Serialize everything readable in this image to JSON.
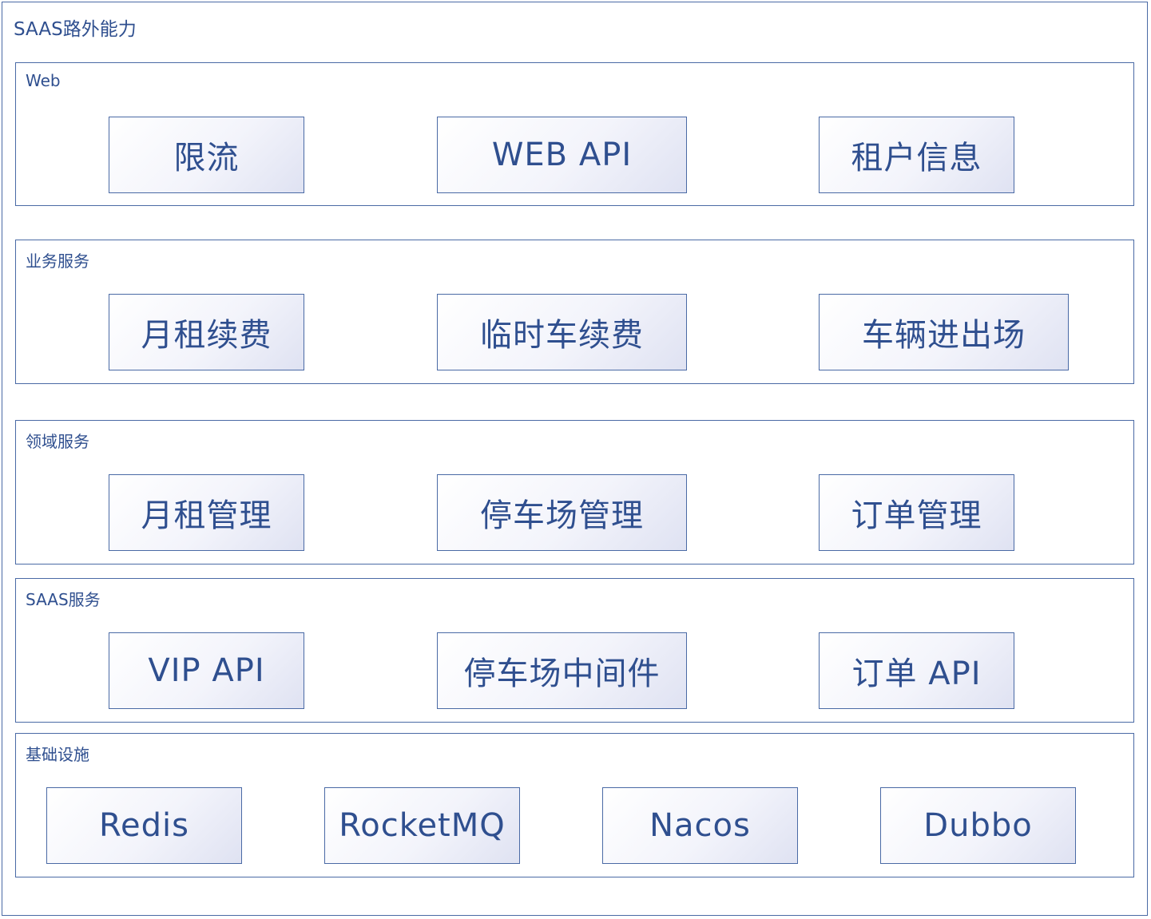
{
  "title": "SAAS路外能力",
  "layers": [
    {
      "label": "Web",
      "items": [
        "限流",
        "WEB API",
        "租户信息"
      ]
    },
    {
      "label": "业务服务",
      "items": [
        "月租续费",
        "临时车续费",
        "车辆进出场"
      ]
    },
    {
      "label": "领域服务",
      "items": [
        "月租管理",
        "停车场管理",
        "订单管理"
      ]
    },
    {
      "label": "SAAS服务",
      "items": [
        "VIP API",
        "停车场中间件",
        "订单 API"
      ]
    },
    {
      "label": "基础设施",
      "items": [
        "Redis",
        "RocketMQ",
        "Nacos",
        "Dubbo"
      ]
    }
  ],
  "colors": {
    "border": "#4a6aa5",
    "text": "#2f4f8f",
    "box_gradient_end": "#dfe2f2"
  }
}
